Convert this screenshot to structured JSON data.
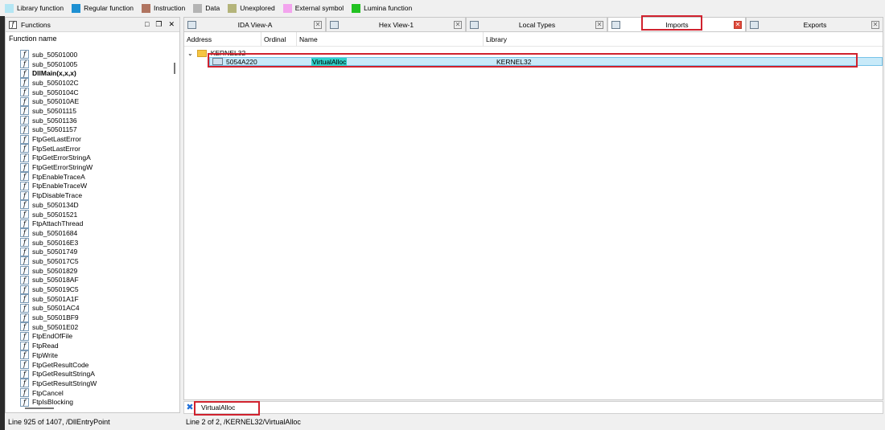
{
  "legend": [
    {
      "label": "Library function",
      "color": "#b4e6f4"
    },
    {
      "label": "Regular function",
      "color": "#1e90d2"
    },
    {
      "label": "Instruction",
      "color": "#b07460"
    },
    {
      "label": "Data",
      "color": "#b4b4b4"
    },
    {
      "label": "Unexplored",
      "color": "#b4b47a"
    },
    {
      "label": "External symbol",
      "color": "#f3a4ee"
    },
    {
      "label": "Lumina function",
      "color": "#22c222"
    }
  ],
  "functions_panel": {
    "title": "Functions",
    "column": "Function name",
    "items": [
      "sub_50501000",
      "sub_50501005",
      "DllMain(x,x,x)",
      "sub_5050102C",
      "sub_5050104C",
      "sub_505010AE",
      "sub_50501115",
      "sub_50501136",
      "sub_50501157",
      "FtpGetLastError",
      "FtpSetLastError",
      "FtpGetErrorStringA",
      "FtpGetErrorStringW",
      "FtpEnableTraceA",
      "FtpEnableTraceW",
      "FtpDisableTrace",
      "sub_5050134D",
      "sub_50501521",
      "FtpAttachThread",
      "sub_50501684",
      "sub_505016E3",
      "sub_50501749",
      "sub_505017C5",
      "sub_50501829",
      "sub_505018AF",
      "sub_505019C5",
      "sub_50501A1F",
      "sub_50501AC4",
      "sub_50501BF9",
      "sub_50501E02",
      "FtpEndOfFile",
      "FtpRead",
      "FtpWrite",
      "FtpGetResultCode",
      "FtpGetResultStringA",
      "FtpGetResultStringW",
      "FtpCancel",
      "FtpIsBlocking"
    ]
  },
  "tabs": [
    {
      "label": "IDA View-A"
    },
    {
      "label": "Hex View-1"
    },
    {
      "label": "Local Types"
    },
    {
      "label": "Imports"
    },
    {
      "label": "Exports"
    }
  ],
  "imports": {
    "columns": [
      "Address",
      "Ordinal",
      "Name",
      "Library"
    ],
    "group": "KERNEL32",
    "row": {
      "address": "5054A220",
      "ordinal": "",
      "name": "VirtualAlloc",
      "library": "KERNEL32"
    }
  },
  "search": {
    "value": "VirtualAlloc"
  },
  "status": {
    "left": "Line 925 of 1407, /DllEntryPoint",
    "right": "Line 2 of 2, /KERNEL32/VirtualAlloc"
  }
}
